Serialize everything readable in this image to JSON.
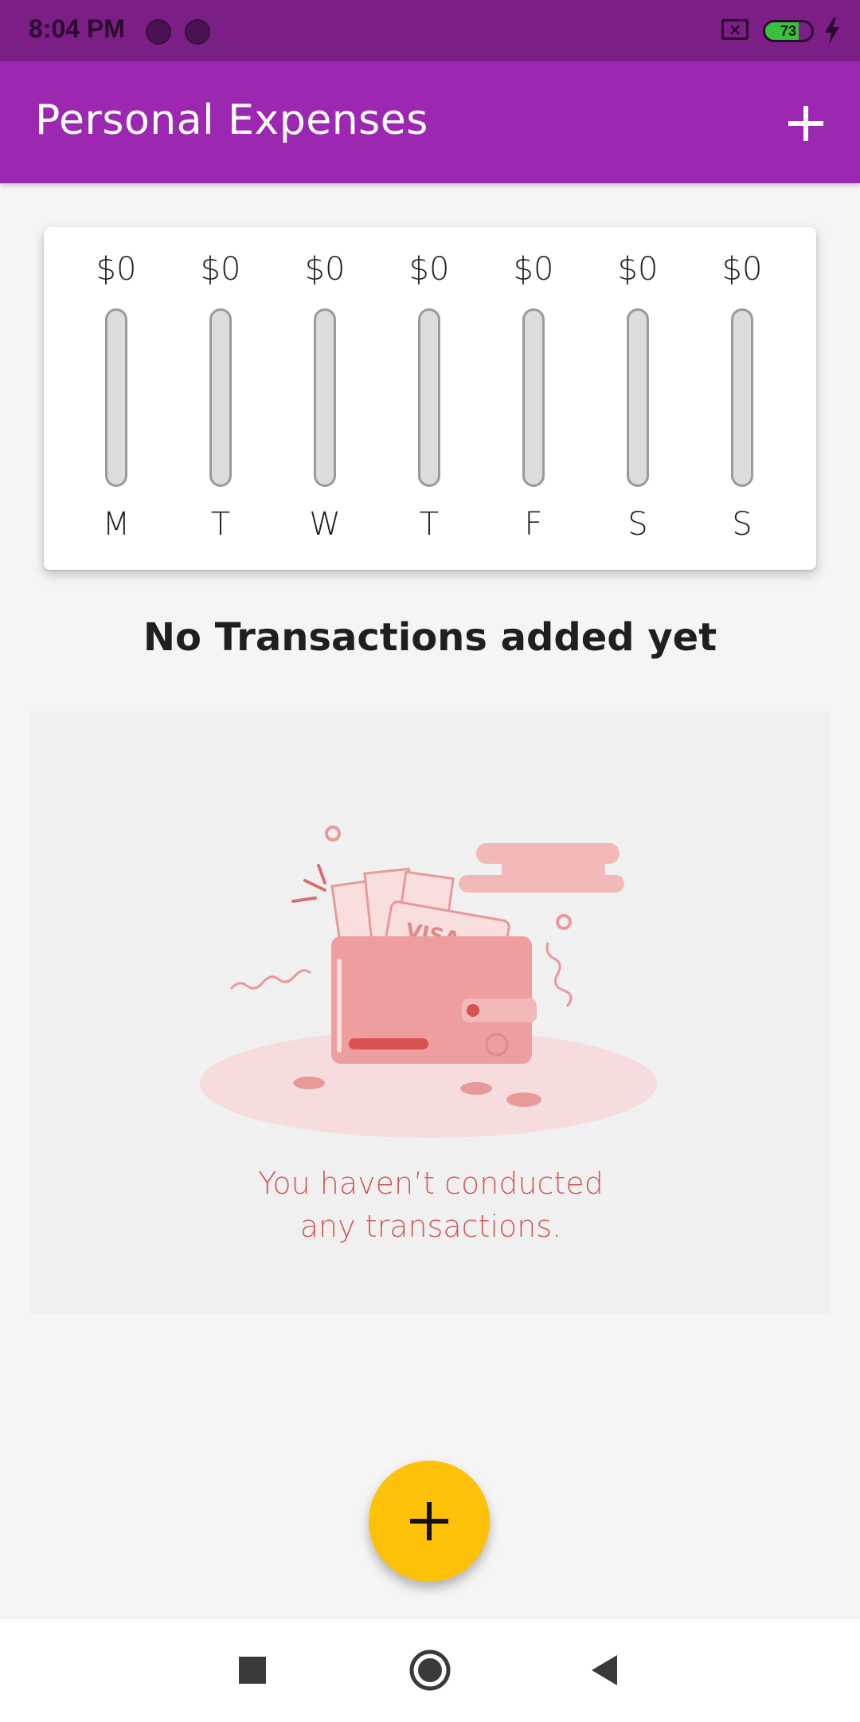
{
  "status_bar": {
    "time": "8:04 PM",
    "battery_level": "73",
    "battery_fraction": 0.73,
    "icons": [
      "notification-dot-icon",
      "notification-dot-icon",
      "no-sim-icon",
      "battery-icon",
      "charging-icon"
    ]
  },
  "app_bar": {
    "title": "Personal Expenses",
    "action_icon": "add-icon"
  },
  "chart": {
    "days": [
      {
        "label": "M",
        "amount": "$0",
        "fraction": 0
      },
      {
        "label": "T",
        "amount": "$0",
        "fraction": 0
      },
      {
        "label": "W",
        "amount": "$0",
        "fraction": 0
      },
      {
        "label": "T",
        "amount": "$0",
        "fraction": 0
      },
      {
        "label": "F",
        "amount": "$0",
        "fraction": 0
      },
      {
        "label": "S",
        "amount": "$0",
        "fraction": 0
      },
      {
        "label": "S",
        "amount": "$0",
        "fraction": 0
      }
    ]
  },
  "empty_state": {
    "title": "No Transactions added yet",
    "message_line1": "You haven’t conducted",
    "message_line2": "any transactions.",
    "illustration_card_text": "VISA"
  },
  "fab": {
    "icon": "add-icon"
  },
  "nav": {
    "icons": [
      "recents-square-icon",
      "home-circle-icon",
      "back-triangle-icon"
    ]
  },
  "colors": {
    "primary": "#9c27b0",
    "status_bar": "#7b1f86",
    "accent": "#fdc107",
    "illustration": "#e89a9a"
  }
}
